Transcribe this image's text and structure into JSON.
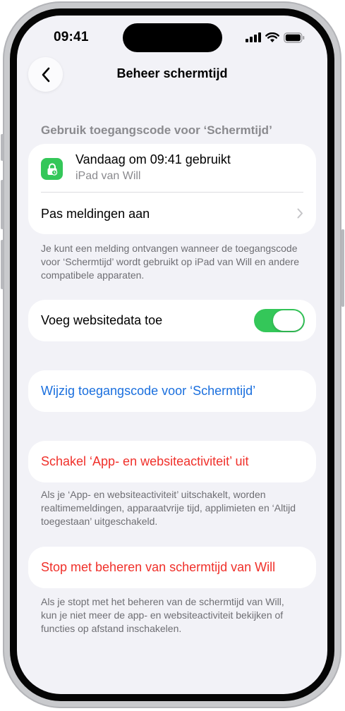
{
  "status_bar": {
    "time": "09:41"
  },
  "nav": {
    "title": "Beheer schermtijd",
    "back_icon": "chevron-left-icon"
  },
  "passcode_section": {
    "header": "Gebruik toegangscode voor ‘Schermtijd’",
    "usage_title": "Vandaag om 09:41 gebruikt",
    "usage_device": "iPad van Will",
    "usage_icon": "lock-clock-icon",
    "notifications_label": "Pas meldingen aan",
    "footnote": "Je kunt een melding ontvangen wanneer de toegangscode voor ‘Schermtijd’ wordt gebruikt op iPad van Will en andere compatibele apparaten."
  },
  "website_data": {
    "label": "Voeg websitedata toe",
    "enabled": true
  },
  "change_passcode": {
    "label": "Wijzig toegangscode voor ‘Schermtijd’"
  },
  "disable_activity": {
    "label": "Schakel ‘App- en websiteactiviteit’ uit",
    "footnote": "Als je ‘App- en websiteactiviteit’ uitschakelt, worden realtimemeldingen, apparaatvrije tijd, applimieten en ‘Altijd toegestaan’ uitgeschakeld."
  },
  "stop_managing": {
    "label": "Stop met beheren van schermtijd van Will",
    "footnote": "Als je stopt met het beheren van de schermtijd van Will, kun je niet meer de app- en websiteactiviteit bekijken of functies op afstand inschakelen."
  },
  "colors": {
    "link_blue": "#1a6fde",
    "destructive_red": "#f0302a",
    "toggle_green": "#34c759",
    "background": "#f2f2f7"
  }
}
